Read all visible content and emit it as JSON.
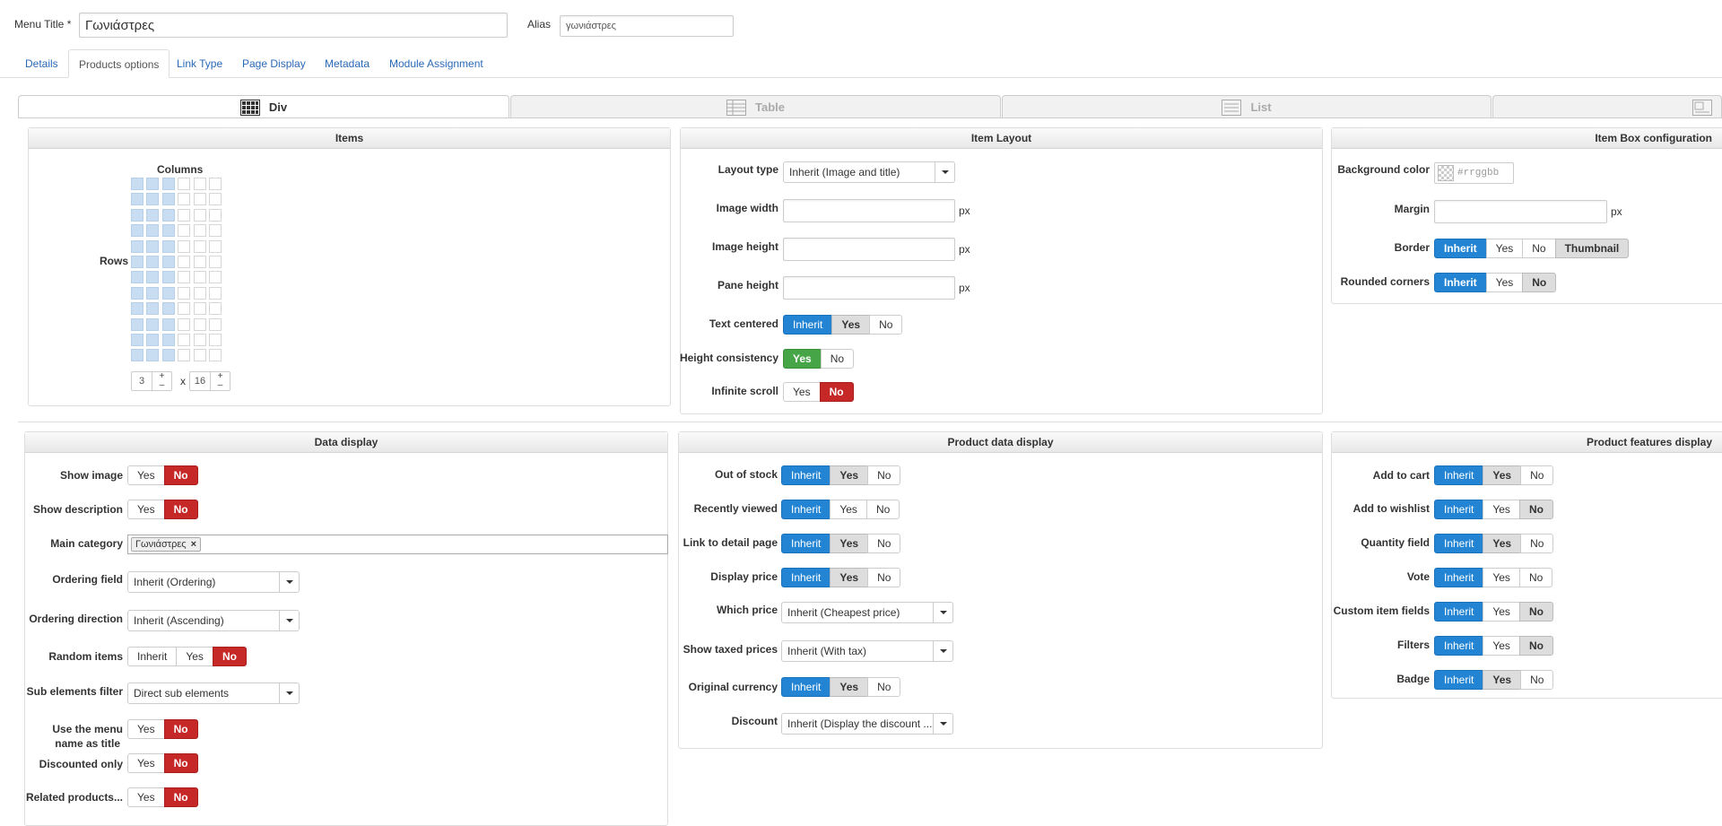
{
  "header": {
    "menu_title_label": "Menu Title *",
    "menu_title_value": "Γωνιάστρες",
    "alias_label": "Alias",
    "alias_value": "γωνιάστρες"
  },
  "tabs": [
    {
      "label": "Details"
    },
    {
      "label": "Products options"
    },
    {
      "label": "Link Type"
    },
    {
      "label": "Page Display"
    },
    {
      "label": "Metadata"
    },
    {
      "label": "Module Assignment"
    }
  ],
  "layout_tabs": [
    {
      "label": "Div",
      "icon": "div-grid-icon"
    },
    {
      "label": "Table",
      "icon": "table-icon"
    },
    {
      "label": "List",
      "icon": "list-icon"
    },
    {
      "label": "",
      "icon": "custom-layout-icon"
    }
  ],
  "items_panel": {
    "title": "Items",
    "columns_label": "Columns",
    "rows_label": "Rows",
    "columns": 3,
    "rows": 16,
    "columns_value": "3",
    "rows_value": "16",
    "x_label": "x",
    "plus": "+",
    "minus": "–"
  },
  "item_layout": {
    "title": "Item Layout",
    "layout_type_label": "Layout type",
    "layout_type_value": "Inherit (Image and title)",
    "image_width_label": "Image width",
    "image_height_label": "Image height",
    "pane_height_label": "Pane height",
    "px": "px",
    "text_centered_label": "Text centered",
    "height_consistency_label": "Height consistency",
    "infinite_scroll_label": "Infinite scroll"
  },
  "item_box": {
    "title": "Item Box configuration",
    "bg_color_label": "Background color",
    "bg_color_placeholder": "#rrggbb",
    "margin_label": "Margin",
    "px": "px",
    "border_label": "Border",
    "rounded_label": "Rounded corners",
    "thumbnail": "Thumbnail"
  },
  "data_display": {
    "title": "Data display",
    "show_image_label": "Show image",
    "show_description_label": "Show description",
    "main_category_label": "Main category",
    "main_category_tag": "Γωνιάστρες",
    "tag_remove": "×",
    "ordering_field_label": "Ordering field",
    "ordering_field_value": "Inherit (Ordering)",
    "ordering_direction_label": "Ordering direction",
    "ordering_direction_value": "Inherit (Ascending)",
    "random_items_label": "Random items",
    "sub_elements_label": "Sub elements filter",
    "sub_elements_value": "Direct sub elements",
    "menu_name_label_1": "Use the menu",
    "menu_name_label_2": "name as title",
    "discounted_label": "Discounted only",
    "related_label": "Related products..."
  },
  "product_data": {
    "title": "Product data display",
    "out_of_stock_label": "Out of stock",
    "recently_viewed_label": "Recently viewed",
    "link_detail_label": "Link to detail page",
    "display_price_label": "Display price",
    "which_price_label": "Which price",
    "which_price_value": "Inherit (Cheapest price)",
    "taxed_label": "Show taxed prices",
    "taxed_value": "Inherit (With tax)",
    "original_currency_label": "Original currency",
    "discount_label": "Discount",
    "discount_value": "Inherit (Display the discount ..."
  },
  "features": {
    "title": "Product features display",
    "add_to_cart_label": "Add to cart",
    "add_to_wishlist_label": "Add to wishlist",
    "quantity_label": "Quantity field",
    "vote_label": "Vote",
    "custom_fields_label": "Custom item fields",
    "filters_label": "Filters",
    "badge_label": "Badge"
  },
  "opt": {
    "inherit": "Inherit",
    "yes": "Yes",
    "no": "No"
  },
  "colors": {
    "blue": "#2384d3",
    "red": "#c52827",
    "green": "#46a546",
    "link": "#2a69b8"
  }
}
